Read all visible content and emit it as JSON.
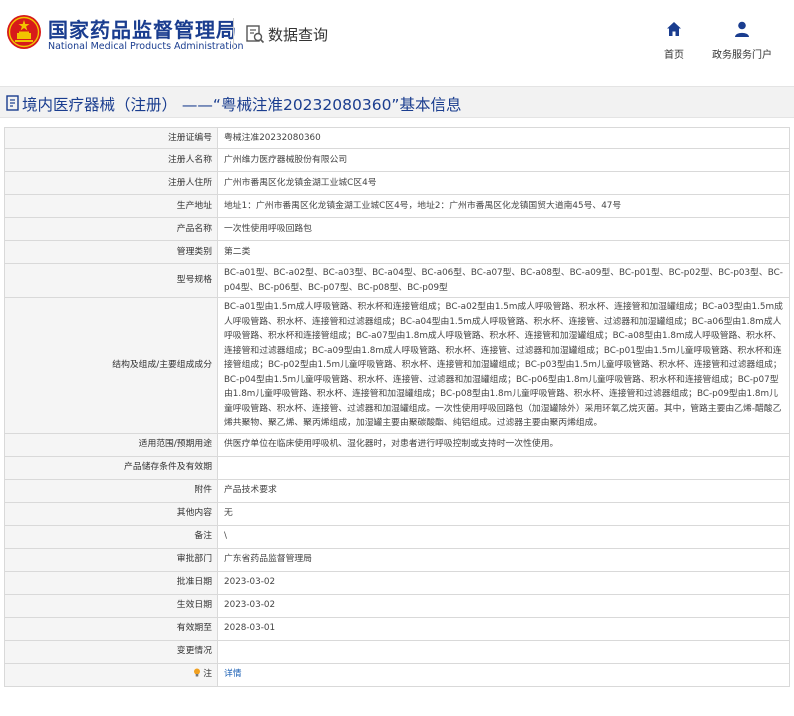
{
  "header": {
    "logo_cn": "国家药品监督管理局",
    "logo_en": "National Medical Products Administration",
    "query_label": "数据查询",
    "nav": [
      {
        "label": "首页",
        "icon": "home-icon"
      },
      {
        "label": "政务服务门户",
        "icon": "user-icon"
      }
    ]
  },
  "page_title": "境内医疗器械（注册） ——“粤械注准20232080360”基本信息",
  "rows": [
    {
      "label": "注册证编号",
      "value": "粤械注准20232080360"
    },
    {
      "label": "注册人名称",
      "value": "广州维力医疗器械股份有限公司"
    },
    {
      "label": "注册人住所",
      "value": "广州市番禺区化龙镇金湖工业城C区4号"
    },
    {
      "label": "生产地址",
      "value": "地址1：广州市番禺区化龙镇金湖工业城C区4号，地址2：广州市番禺区化龙镇国贸大道南45号、47号"
    },
    {
      "label": "产品名称",
      "value": "一次性使用呼吸回路包"
    },
    {
      "label": "管理类别",
      "value": "第二类"
    },
    {
      "label": "型号规格",
      "value": "BC-a01型、BC-a02型、BC-a03型、BC-a04型、BC-a06型、BC-a07型、BC-a08型、BC-a09型、BC-p01型、BC-p02型、BC-p03型、BC-p04型、BC-p06型、BC-p07型、BC-p08型、BC-p09型"
    },
    {
      "label": "结构及组成/主要组成成分",
      "value": "BC-a01型由1.5m成人呼吸管路、积水杯和连接管组成；BC-a02型由1.5m成人呼吸管路、积水杯、连接管和加湿罐组成；BC-a03型由1.5m成人呼吸管路、积水杯、连接管和过滤器组成；BC-a04型由1.5m成人呼吸管路、积水杯、连接管、过滤器和加湿罐组成；BC-a06型由1.8m成人呼吸管路、积水杯和连接管组成；BC-a07型由1.8m成人呼吸管路、积水杯、连接管和加湿罐组成；BC-a08型由1.8m成人呼吸管路、积水杯、连接管和过滤器组成；BC-a09型由1.8m成人呼吸管路、积水杯、连接管、过滤器和加湿罐组成；BC-p01型由1.5m儿童呼吸管路、积水杯和连接管组成；BC-p02型由1.5m儿童呼吸管路、积水杯、连接管和加湿罐组成；BC-p03型由1.5m儿童呼吸管路、积水杯、连接管和过滤器组成；BC-p04型由1.5m儿童呼吸管路、积水杯、连接管、过滤器和加湿罐组成；BC-p06型由1.8m儿童呼吸管路、积水杯和连接管组成；BC-p07型由1.8m儿童呼吸管路、积水杯、连接管和加湿罐组成；BC-p08型由1.8m儿童呼吸管路、积水杯、连接管和过滤器组成；BC-p09型由1.8m儿童呼吸管路、积水杯、连接管、过滤器和加湿罐组成。一次性使用呼吸回路包（加湿罐除外）采用环氧乙烷灭菌。其中，管路主要由乙烯-醋酸乙烯共聚物、聚乙烯、聚丙烯组成，加湿罐主要由聚碳酸酯、纯铝组成。过滤器主要由聚丙烯组成。"
    },
    {
      "label": "适用范围/预期用途",
      "value": "供医疗单位在临床使用呼吸机、湿化器时，对患者进行呼吸控制或支持时一次性使用。"
    },
    {
      "label": "产品储存条件及有效期",
      "value": ""
    },
    {
      "label": "附件",
      "value": "产品技术要求"
    },
    {
      "label": "其他内容",
      "value": "无"
    },
    {
      "label": "备注",
      "value": "\\"
    },
    {
      "label": "审批部门",
      "value": "广东省药品监督管理局"
    },
    {
      "label": "批准日期",
      "value": "2023-03-02"
    },
    {
      "label": "生效日期",
      "value": "2023-03-02"
    },
    {
      "label": "有效期至",
      "value": "2028-03-01"
    },
    {
      "label": "变更情况",
      "value": ""
    },
    {
      "label": "注",
      "value": "详情"
    }
  ],
  "colors": {
    "brand_blue": "#1a3d8f",
    "link_blue": "#1a5fb4",
    "emblem_red": "#d71a1a",
    "emblem_gold": "#f2c300"
  }
}
